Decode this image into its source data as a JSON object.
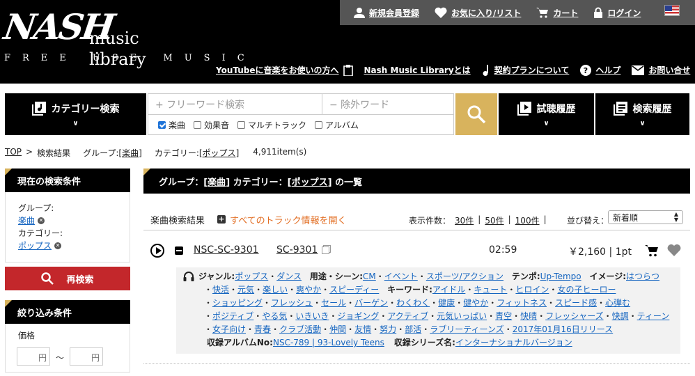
{
  "logo": {
    "nash": "NASH",
    "music_library": "music library",
    "tagline": "FREE USE MUSIC"
  },
  "topbar": {
    "register": "新規会員登録",
    "favorites": "お気に入り/リスト",
    "cart": "カート",
    "login": "ログイン"
  },
  "subnav": {
    "youtube": "YouTubeに音楽をお使いの方へ",
    "about": "Nash Music Libraryとは",
    "plan": "契約プランについて",
    "help": "ヘルプ",
    "contact": "お問い合せ"
  },
  "search": {
    "category_label": "カテゴリー検索",
    "freeword_placeholder": "+ フリーワード検索",
    "exclude_placeholder": "− 除外ワード",
    "checks": [
      {
        "label": "楽曲",
        "checked": true
      },
      {
        "label": "効果音",
        "checked": false
      },
      {
        "label": "マルチトラック",
        "checked": false
      },
      {
        "label": "アルバム",
        "checked": false
      }
    ],
    "history_label": "試聴履歴",
    "search_history_label": "検索履歴"
  },
  "breadcrumb": {
    "top": "TOP",
    "sep": ">",
    "results": "検索結果",
    "group_prefix": "グループ:[",
    "group": "楽曲",
    "close": "]",
    "category_prefix": "カテゴリー:[",
    "category": "ポップス",
    "count": "4,911item(s)"
  },
  "sidebar": {
    "current_title": "現在の検索条件",
    "group_label": "グループ:",
    "group_value": "楽曲",
    "category_label": "カテゴリー:",
    "category_value": "ポップス",
    "research": "再検索",
    "refine_title": "絞り込み条件",
    "price_label": "価格",
    "yen": "円",
    "tilde": "〜"
  },
  "main": {
    "head_group": "グループ：[",
    "head_group_val": "楽曲",
    "head_cat": "] カテゴリー：[",
    "head_cat_val": "ポップス",
    "head_tail": "] の一覧",
    "result_title": "楽曲検索結果",
    "open_all": "すべてのトラック情報を開く",
    "perpage_label": "表示件数：",
    "pp30": "30件",
    "pp50": "50件",
    "pp100": "100件",
    "sep": "|",
    "sort_label": "並び替え：",
    "sort_value": "新着順"
  },
  "track": {
    "number": "NSC-SC-9301",
    "short": "SC-9301",
    "duration": "02:59",
    "price": "￥2,160",
    "sep": "|",
    "points": "1pt",
    "genre_label": "ジャンル:",
    "genres": [
      "ポップス",
      "ダンス"
    ],
    "scene_label": "用途・シーン:",
    "scenes": [
      "CM",
      "イベント",
      "スポーツ/アクション"
    ],
    "tempo_label": "テンポ:",
    "tempo": "Up-Tempo",
    "image_label": "イメージ:",
    "images": [
      "はつらつ",
      "快活",
      "元気",
      "楽しい",
      "爽やか",
      "スピーディー"
    ],
    "keyword_label": "キーワード:",
    "keywords1": [
      "アイドル",
      "キュート",
      "ヒロイン",
      "女の子ヒーロー"
    ],
    "keywords2": [
      "ショッピング",
      "フレッシュ",
      "セール",
      "バーゲン",
      "わくわく",
      "健康",
      "健やか",
      "フィットネス",
      "スピード感",
      "心弾む"
    ],
    "keywords3": [
      "ポジティブ",
      "やる気",
      "いきいき",
      "ジョギング",
      "アクティブ",
      "元気いっぱい",
      "青空",
      "快晴",
      "フレッシャーズ",
      "快調",
      "ティーン"
    ],
    "keywords4": [
      "女子向け",
      "青春",
      "クラブ活動",
      "仲間",
      "友情",
      "努力",
      "部活",
      "ラブリーティーンズ",
      "2017年01月16日リリース"
    ],
    "album_label": "収録アルバムNo:",
    "album": "NSC-789 | 93-Lovely Teens",
    "series_label": "収録シリーズ名:",
    "series": "インターナショナルバージョン"
  }
}
